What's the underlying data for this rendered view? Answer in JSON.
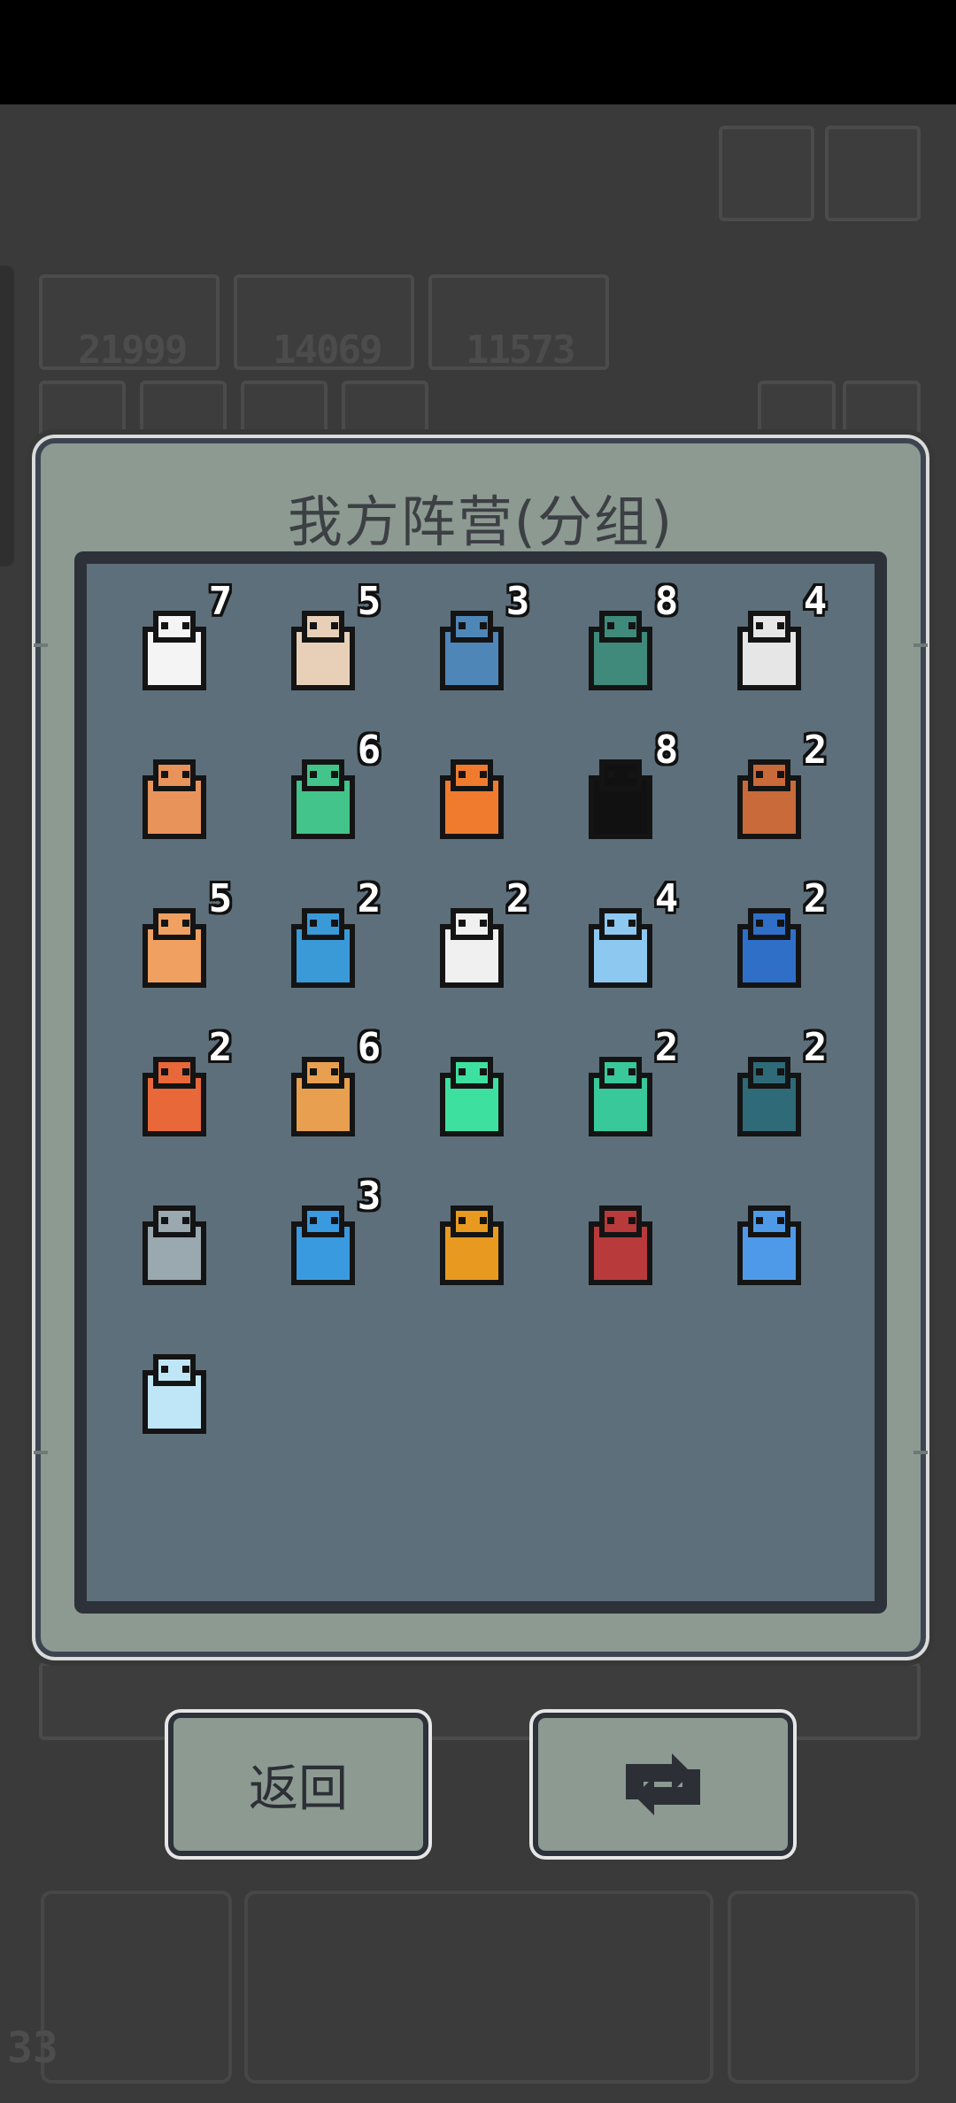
{
  "background": {
    "scores": [
      "21999",
      "14069",
      "11573"
    ],
    "level": "33"
  },
  "modal": {
    "title": "我方阵营(分组)",
    "units": [
      {
        "name": "white-dog-spirit-icon",
        "count": "7",
        "color": "#f4f4f4"
      },
      {
        "name": "old-fisherman-icon",
        "count": "5",
        "color": "#e8d0b8"
      },
      {
        "name": "ice-dragon-icon",
        "count": "3",
        "color": "#4f86b8"
      },
      {
        "name": "mushroom-monster-icon",
        "count": "8",
        "color": "#3f8a7a"
      },
      {
        "name": "ghost-sage-icon",
        "count": "4",
        "color": "#e6e6e6"
      },
      {
        "name": "treasure-chest-icon",
        "count": "",
        "color": "#e8935a"
      },
      {
        "name": "green-mantis-icon",
        "count": "6",
        "color": "#43c48a"
      },
      {
        "name": "fire-spirit-icon",
        "count": "",
        "color": "#f07b2e"
      },
      {
        "name": "grin-bomb-icon",
        "count": "8",
        "color": "#111111"
      },
      {
        "name": "scarecrow-icon",
        "count": "2",
        "color": "#c96a3a"
      },
      {
        "name": "miner-icon",
        "count": "5",
        "color": "#f0a060"
      },
      {
        "name": "blue-crab-icon",
        "count": "2",
        "color": "#3a9ad8"
      },
      {
        "name": "white-wyvern-icon",
        "count": "2",
        "color": "#f0f0f0"
      },
      {
        "name": "ice-bird-icon",
        "count": "4",
        "color": "#8cc8f0"
      },
      {
        "name": "blue-cabinet-icon",
        "count": "2",
        "color": "#2f6fc8"
      },
      {
        "name": "phoenix-icon",
        "count": "2",
        "color": "#e8683a"
      },
      {
        "name": "sand-dragon-icon",
        "count": "6",
        "color": "#e8a050"
      },
      {
        "name": "emerald-gem-icon",
        "count": "",
        "color": "#3ee0a0"
      },
      {
        "name": "green-core-icon",
        "count": "2",
        "color": "#38c89a"
      },
      {
        "name": "tree-guardian-icon",
        "count": "2",
        "color": "#2e6a78"
      },
      {
        "name": "skull-demon-icon",
        "count": "",
        "color": "#9aa8b0"
      },
      {
        "name": "crystal-rock-icon",
        "count": "3",
        "color": "#3a9ae0"
      },
      {
        "name": "golden-horned-beast-icon",
        "count": "",
        "color": "#e89a20"
      },
      {
        "name": "red-imp-icon",
        "count": "",
        "color": "#b83a3a"
      },
      {
        "name": "blue-orb-icon",
        "count": "",
        "color": "#4f9ae8"
      },
      {
        "name": "ice-flame-icon",
        "count": "",
        "color": "#bfe6f7"
      }
    ]
  },
  "buttons": {
    "back_label": "返回",
    "refresh_icon": "refresh-icon"
  }
}
